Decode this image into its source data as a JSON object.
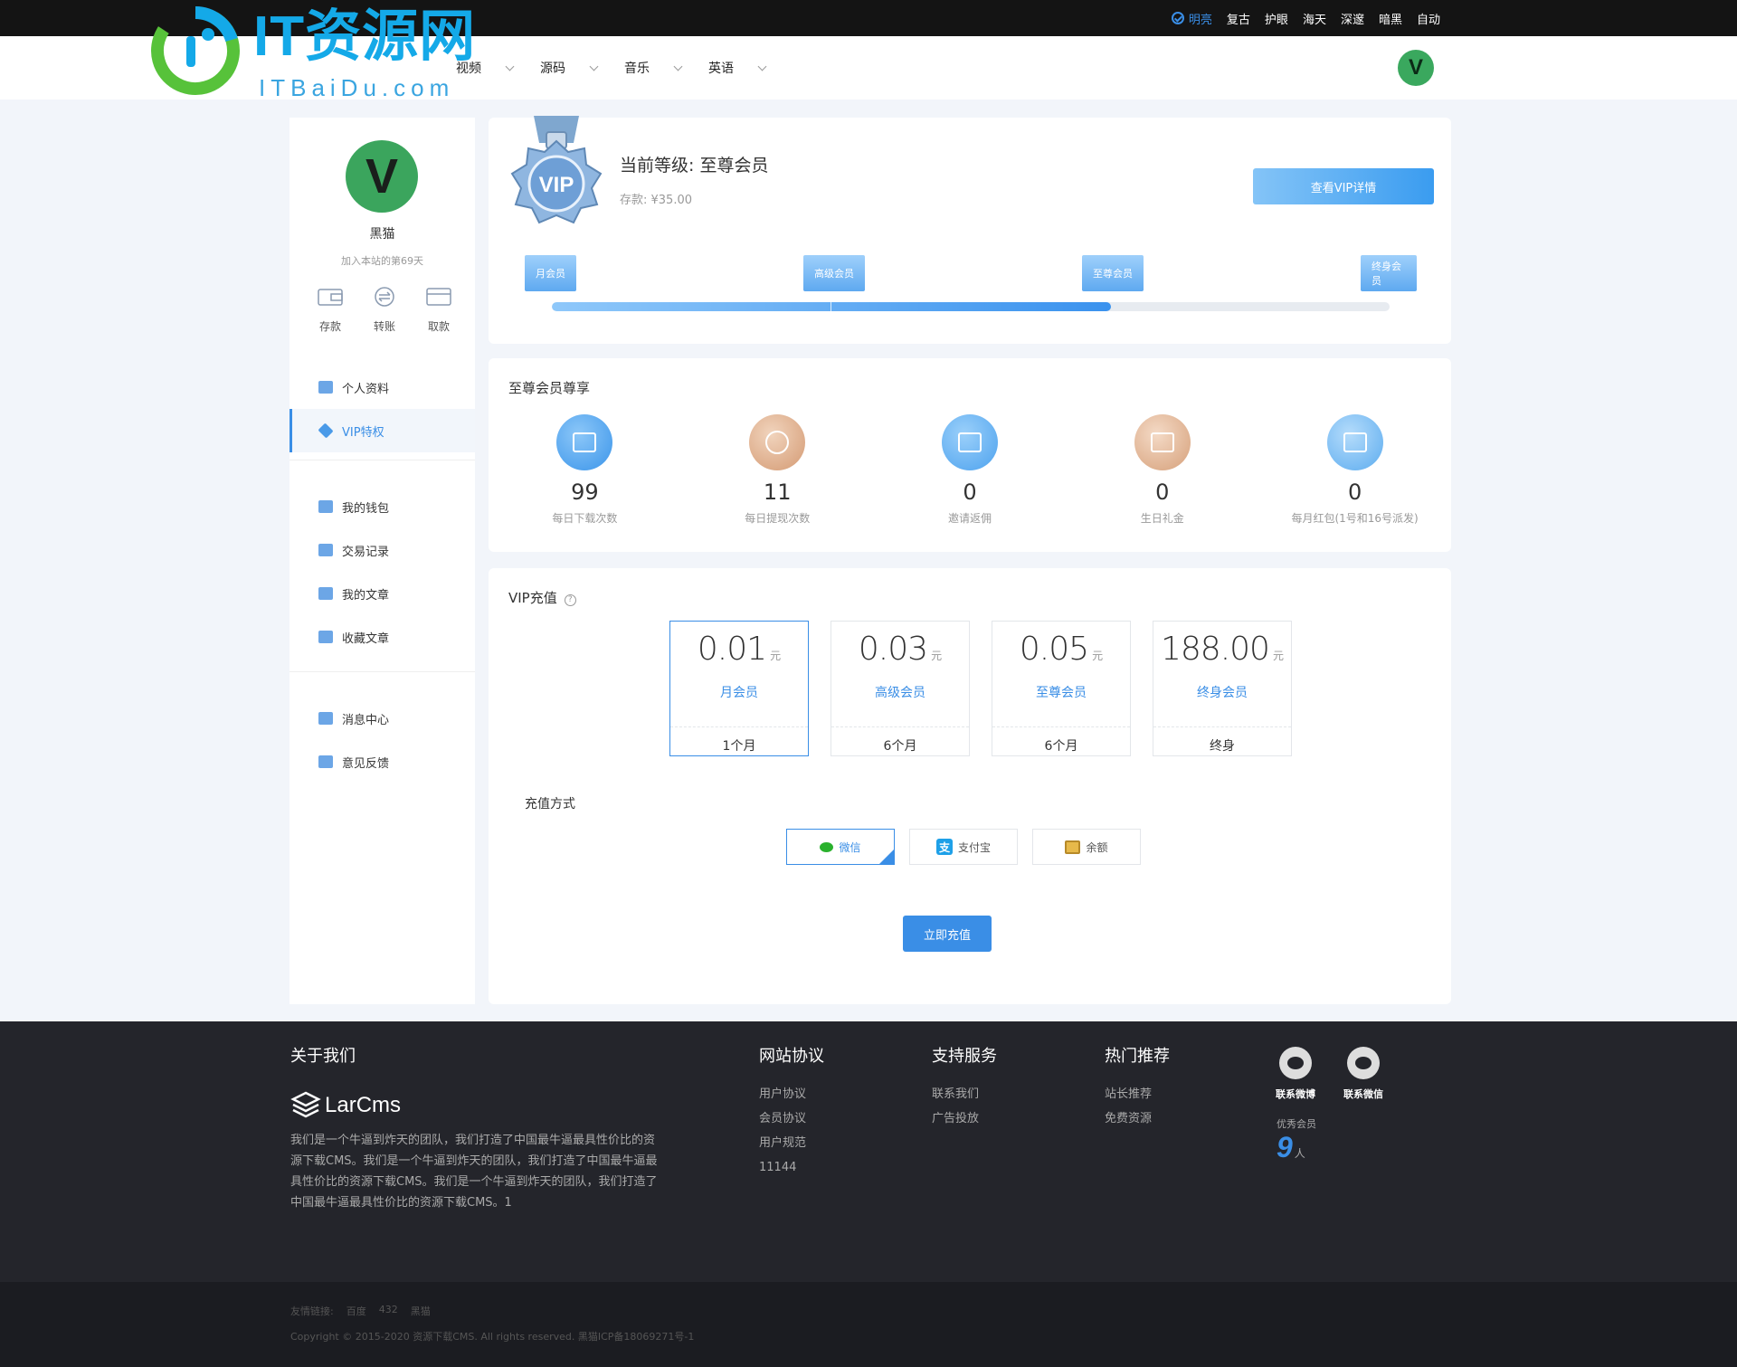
{
  "theme_bar": {
    "items": [
      {
        "label": "明亮",
        "active": true
      },
      {
        "label": "复古",
        "active": false
      },
      {
        "label": "护眼",
        "active": false
      },
      {
        "label": "海天",
        "active": false
      },
      {
        "label": "深邃",
        "active": false
      },
      {
        "label": "暗黑",
        "active": false
      },
      {
        "label": "自动",
        "active": false
      }
    ]
  },
  "header": {
    "logo_text": "IT资源网",
    "logo_sub": "ITBaiDu.com",
    "nav": [
      "视频",
      "源码",
      "音乐",
      "英语"
    ],
    "avatar_letter": "V"
  },
  "sidebar": {
    "avatar_letter": "V",
    "username": "黑猫",
    "join_days": "加入本站的第69天",
    "wallet_actions": [
      "存款",
      "转账",
      "取款"
    ],
    "menu_group1": [
      "个人资料",
      "VIP特权"
    ],
    "menu_group2": [
      "我的钱包",
      "交易记录",
      "我的文章",
      "收藏文章"
    ],
    "menu_group3": [
      "消息中心",
      "意见反馈"
    ],
    "active_item": "VIP特权"
  },
  "level": {
    "medal_text": "VIP",
    "title": "当前等级: 至尊会员",
    "balance": "存款: ¥35.00",
    "detail_button": "查看VIP详情",
    "tiers": [
      "月会员",
      "高级会员",
      "至尊会员",
      "终身会员"
    ],
    "progress_fraction": 0.667
  },
  "privileges": {
    "title": "至尊会员尊享",
    "items": [
      {
        "value": "99",
        "label": "每日下载次数",
        "color": "#4aa3f0"
      },
      {
        "value": "11",
        "label": "每日提现次数",
        "color": "#e1b08c"
      },
      {
        "value": "0",
        "label": "邀请返佣",
        "color": "#4aa3f0"
      },
      {
        "value": "0",
        "label": "生日礼金",
        "color": "#e1b08c"
      },
      {
        "value": "0",
        "label": "每月红包(1号和16号派发)",
        "color": "#6ab5f3"
      }
    ]
  },
  "recharge": {
    "title": "VIP充值",
    "help": "?",
    "plans": [
      {
        "amount": "0.01",
        "unit": "元",
        "name": "月会员",
        "duration": "1个月",
        "selected": true
      },
      {
        "amount": "0.03",
        "unit": "元",
        "name": "高级会员",
        "duration": "6个月",
        "selected": false
      },
      {
        "amount": "0.05",
        "unit": "元",
        "name": "至尊会员",
        "duration": "6个月",
        "selected": false
      },
      {
        "amount": "188.00",
        "unit": "元",
        "name": "终身会员",
        "duration": "终身",
        "selected": false
      }
    ],
    "pay_title": "充值方式",
    "pay_methods": [
      {
        "label": "微信",
        "icon": "wechat-icon",
        "selected": true
      },
      {
        "label": "支付宝",
        "icon": "alipay-icon",
        "selected": false
      },
      {
        "label": "余额",
        "icon": "balance-icon",
        "selected": false
      }
    ],
    "alipay_glyph": "支",
    "submit": "立即充值"
  },
  "footer": {
    "about_title": "关于我们",
    "brand": "LarCms",
    "about_text": "我们是一个牛逼到炸天的团队，我们打造了中国最牛逼最具性价比的资源下载CMS。我们是一个牛逼到炸天的团队，我们打造了中国最牛逼最具性价比的资源下载CMS。我们是一个牛逼到炸天的团队，我们打造了中国最牛逼最具性价比的资源下载CMS。1",
    "col_agreement": {
      "title": "网站协议",
      "links": [
        "用户协议",
        "会员协议",
        "用户规范",
        "11144"
      ]
    },
    "col_support": {
      "title": "支持服务",
      "links": [
        "联系我们",
        "广告投放"
      ]
    },
    "col_hot": {
      "title": "热门推荐",
      "links": [
        "站长推荐",
        "免费资源"
      ]
    },
    "social": [
      "联系微博",
      "联系微信"
    ],
    "members_label": "优秀会员",
    "members_count": "9",
    "members_unit": "人",
    "friend_links": [
      "友情链接:",
      "百度",
      "432",
      "黑猫"
    ],
    "copyright": "Copyright © 2015-2020 资源下载CMS. All rights reserved. 黑猫ICP备18069271号-1"
  }
}
